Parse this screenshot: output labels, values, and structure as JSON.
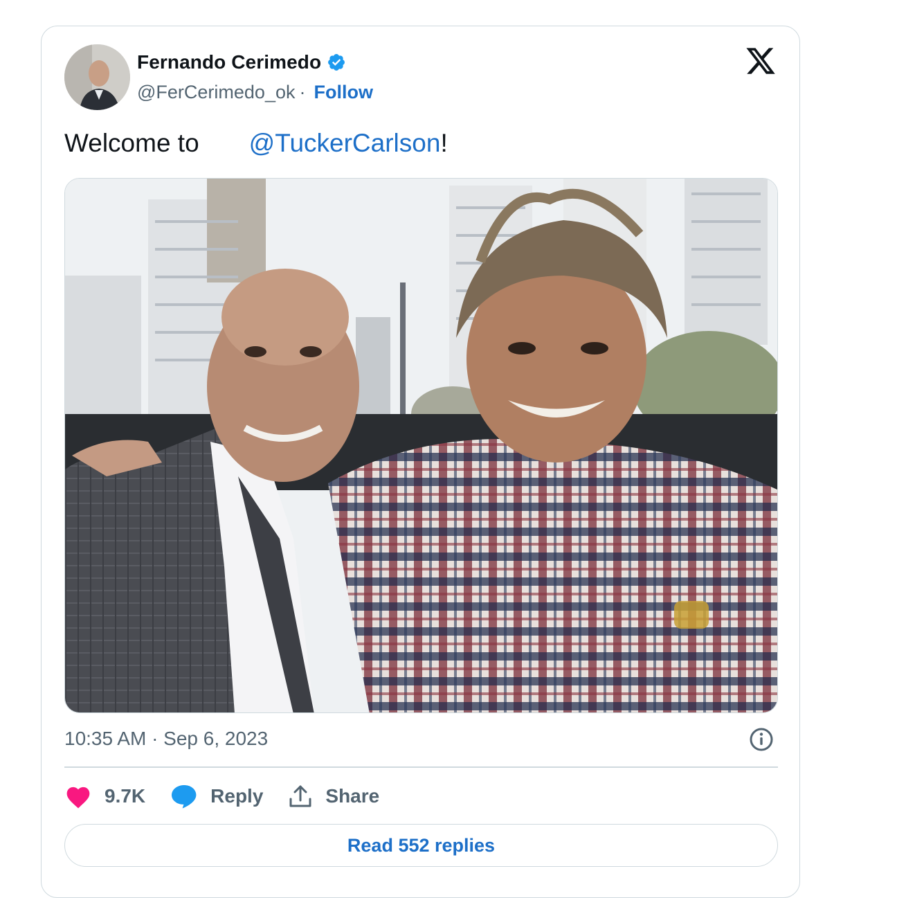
{
  "tweet": {
    "author_name": "Fernando Cerimedo",
    "handle": "@FerCerimedo_ok",
    "separator": "·",
    "follow_label": "Follow",
    "text_prefix": "Welcome to",
    "flag_icon": "argentina-flag-icon",
    "mention": "@TuckerCarlson",
    "text_suffix": "!",
    "timestamp": "10:35 AM · Sep 6, 2023",
    "like_count": "9.7K",
    "reply_label": "Reply",
    "share_label": "Share",
    "read_replies_label": "Read 552 replies"
  },
  "icons": {
    "verified": "verified-badge-icon",
    "platform": "x-logo-icon",
    "info": "info-icon",
    "like": "heart-icon",
    "reply": "speech-bubble-icon",
    "share": "share-icon"
  },
  "colors": {
    "link": "#1d6fc8",
    "verified": "#1d9bf0",
    "heart": "#f91880",
    "muted": "#536471",
    "border": "#cfd9de"
  }
}
